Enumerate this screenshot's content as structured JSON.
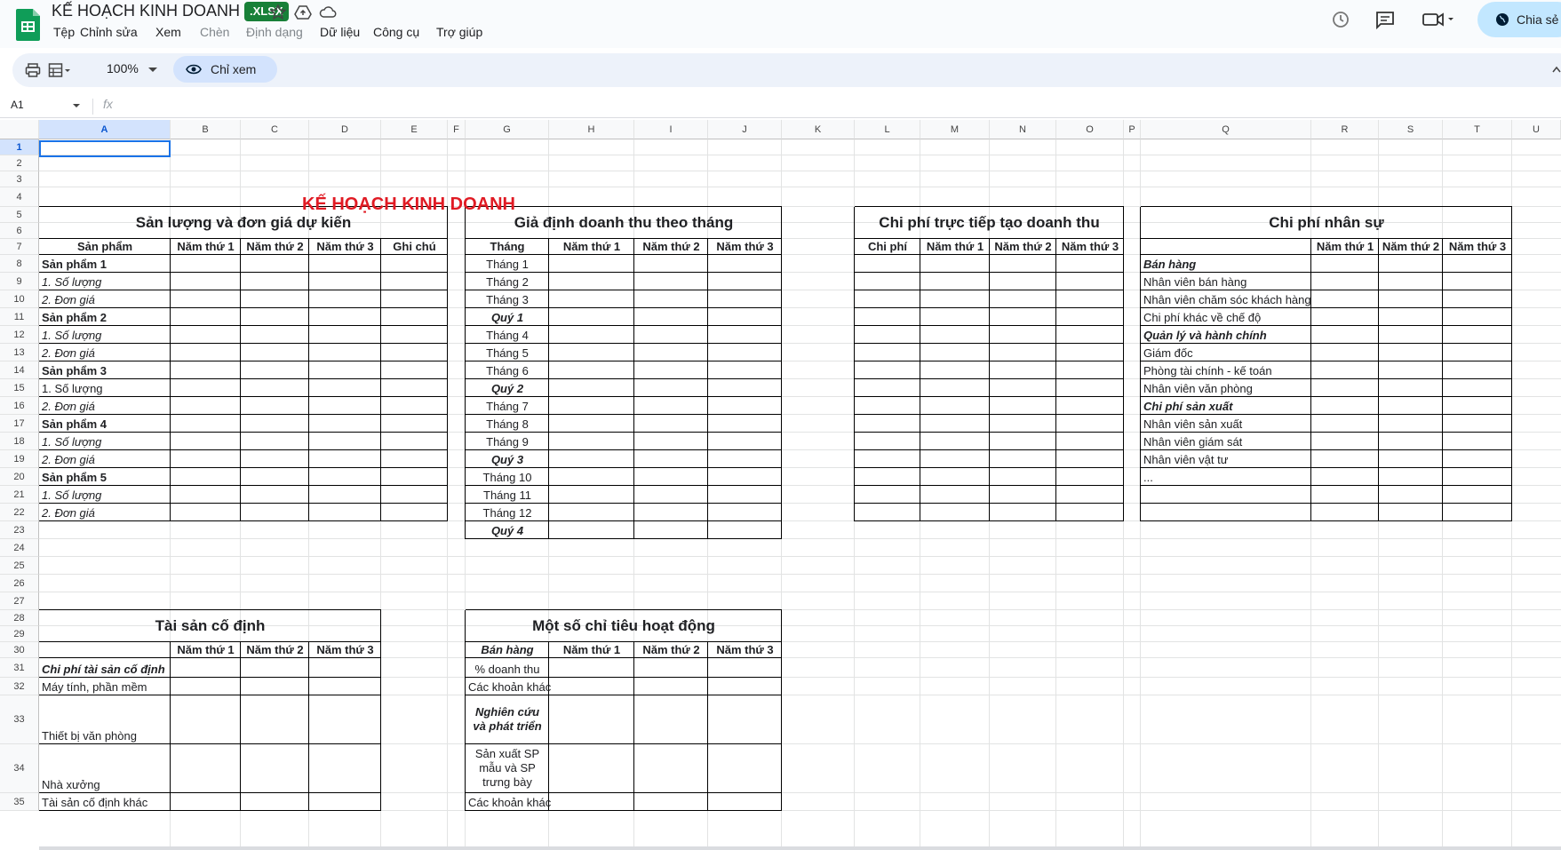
{
  "app": {
    "title": "KẾ HOẠCH KINH DOANH",
    "badge": ".XLSX",
    "menu": [
      "Tệp",
      "Chỉnh sửa",
      "Xem",
      "Chèn",
      "Định dạng",
      "Dữ liệu",
      "Công cụ",
      "Trợ giúp"
    ],
    "share_label": "Chia sẻ",
    "zoom": "100%",
    "view_only_label": "Chỉ xem",
    "name_box": "A1",
    "fx": "fx"
  },
  "colors": {
    "accent": "#1a73e8",
    "title_red": "#e01b24",
    "badge_green": "#188038",
    "share_bg": "#c2e7ff"
  },
  "columns": [
    "A",
    "B",
    "C",
    "D",
    "E",
    "F",
    "G",
    "H",
    "I",
    "J",
    "K",
    "L",
    "M",
    "N",
    "O",
    "P",
    "Q",
    "R",
    "S",
    "T",
    "U"
  ],
  "rows": [
    "1",
    "2",
    "3",
    "4",
    "5",
    "6",
    "7",
    "8",
    "9",
    "10",
    "11",
    "12",
    "13",
    "14",
    "15",
    "16",
    "17",
    "18",
    "19",
    "20",
    "21",
    "22",
    "23",
    "24",
    "25",
    "26",
    "27",
    "28",
    "29",
    "30",
    "31",
    "32",
    "33",
    "34",
    "35"
  ],
  "sheet": {
    "main_title": "KẾ HOẠCH KINH DOANH",
    "t1": {
      "title": "Sản lượng và đơn giá dự kiến",
      "headers": [
        "Sản phẩm",
        "Năm thứ 1",
        "Năm thứ 2",
        "Năm thứ 3",
        "Ghi chú"
      ],
      "rows": [
        "Sản phẩm 1",
        "1. Số lượng",
        "2. Đơn giá",
        "Sản phẩm 2",
        "1. Số lượng",
        "2. Đơn giá",
        "Sản phẩm 3",
        "1. Số lượng",
        "2. Đơn giá",
        "Sản phẩm 4",
        "1. Số lượng",
        "2. Đơn giá",
        "Sản phẩm 5",
        "1. Số lượng",
        "2. Đơn giá"
      ]
    },
    "t2": {
      "title": "Giả định doanh thu theo tháng",
      "headers": [
        "Tháng",
        "Năm thứ 1",
        "Năm thứ 2",
        "Năm thứ 3"
      ],
      "rows": [
        "Tháng 1",
        "Tháng 2",
        "Tháng 3",
        "Quý 1",
        "Tháng 4",
        "Tháng 5",
        "Tháng 6",
        "Quý 2",
        "Tháng 7",
        "Tháng 8",
        "Tháng 9",
        "Quý 3",
        "Tháng 10",
        "Tháng 11",
        "Tháng 12",
        "Quý 4"
      ]
    },
    "t3": {
      "title": "Chi phí trực tiếp tạo doanh thu",
      "headers": [
        "Chi phí",
        "Năm thứ 1",
        "Năm thứ 2",
        "Năm thứ 3"
      ]
    },
    "t4": {
      "title": "Chi phí nhân sự",
      "headers": [
        "",
        "Năm thứ 1",
        "Năm thứ 2",
        "Năm thứ 3"
      ],
      "rows": [
        "Bán hàng",
        "Nhân viên bán hàng",
        "Nhân viên chăm sóc khách hàng",
        "Chi phí khác về chế độ",
        "Quản lý và hành chính",
        "Giám đốc",
        "Phòng tài chính - kế toán",
        "Nhân viên văn phòng",
        "Chi phí sản xuất",
        "Nhân viên sản xuất",
        "Nhân viên giám sát",
        "Nhân viên vật tư",
        "..."
      ]
    },
    "t5": {
      "title": "Tài sản cố định",
      "headers": [
        "",
        "Năm thứ 1",
        "Năm thứ 2",
        "Năm thứ 3"
      ],
      "rows": [
        "Chi phí tài sản cố định",
        "Máy tính, phần mềm",
        "Thiết bị văn phòng",
        "Nhà xưởng",
        "Tài sản cố định khác"
      ]
    },
    "t6": {
      "title": "Một số chỉ tiêu hoạt động",
      "headers": [
        "Bán hàng",
        "Năm thứ 1",
        "Năm thứ 2",
        "Năm thứ 3"
      ],
      "rows": [
        "% doanh thu",
        "Các khoản khác",
        "Nghiên cứu và phát triển",
        "Sản xuất SP mẫu và SP trưng bày",
        "Các khoản khác"
      ]
    }
  }
}
